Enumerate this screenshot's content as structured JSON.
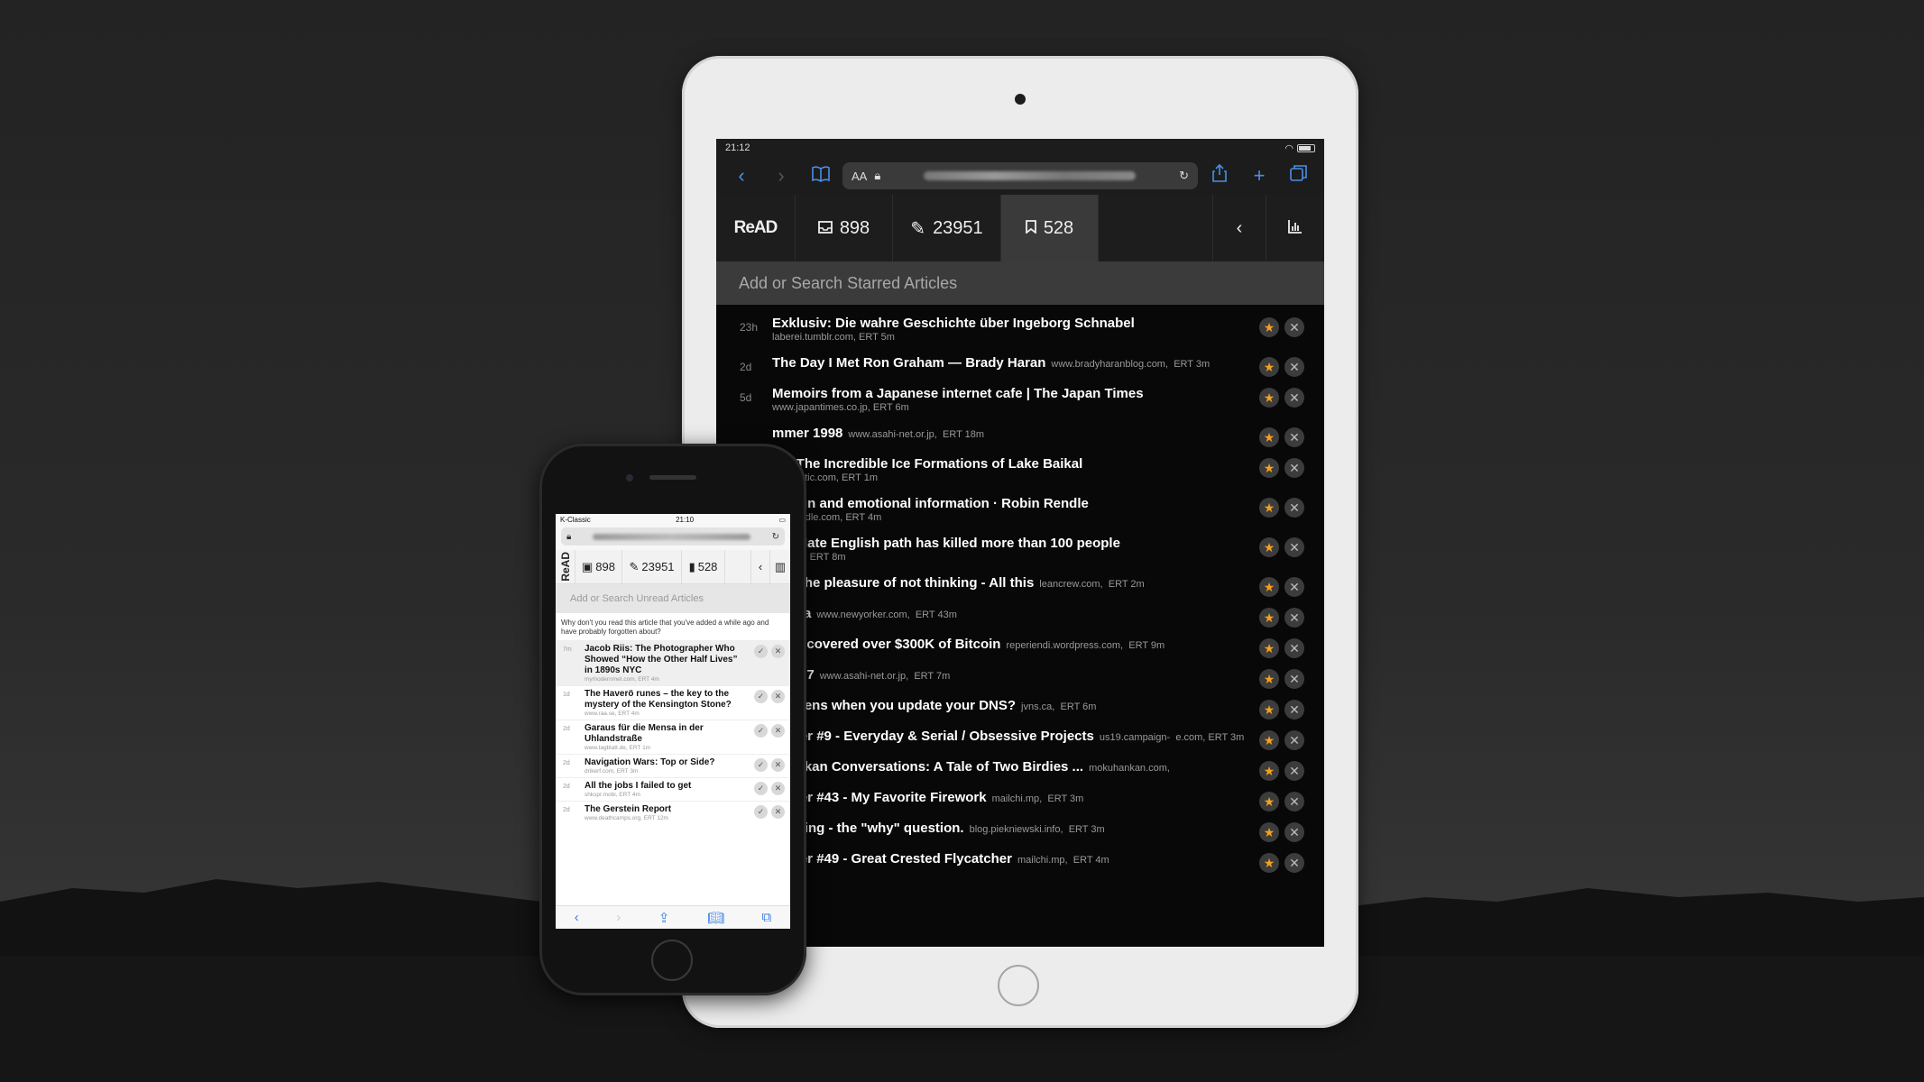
{
  "ipad": {
    "status_time": "21:12",
    "url_aa": "AA",
    "nav": {
      "logo": "ReAD",
      "unread_count": "898",
      "archived_count": "23951",
      "starred_count": "528",
      "back_symbol": "‹"
    },
    "search_placeholder": "Add or Search Starred Articles",
    "articles": [
      {
        "age": "23h",
        "title": "Exklusiv: Die wahre Geschichte über Ingeborg Schnabel",
        "domain": "laberei.tumblr.com,",
        "ert": "ERT 5m",
        "inline": false
      },
      {
        "age": "2d",
        "title": "The Day I Met Ron Graham — Brady Haran",
        "domain": "www.bradyharanblog.com,",
        "ert": "ERT 3m",
        "inline": true
      },
      {
        "age": "5d",
        "title": "Memoirs from a Japanese internet cafe | The Japan Times",
        "domain": "www.japantimes.co.jp,",
        "ert": "ERT 6m",
        "inline": false
      },
      {
        "age": "",
        "title": "mmer 1998",
        "domain": "www.asahi-net.or.jp,",
        "ert": "ERT 18m",
        "inline": true
      },
      {
        "age": "",
        "title": "os: The Incredible Ice Formations of Lake Baikal",
        "domain": "heatlantic.com,",
        "ert": "ERT 1m",
        "inline": false
      },
      {
        "age": "",
        "title": "design and emotional information · Robin Rendle",
        "domain": "bbinrendle.com,",
        "ert": "ERT 4m",
        "inline": false
      },
      {
        "age": "",
        "title": "desolate English path has killed more than 100 people",
        "domain": "pc.com,",
        "ert": "ERT 8m",
        "inline": false
      },
      {
        "age": "",
        "title": "and the pleasure of not thinking - All this",
        "domain": "leancrew.com,",
        "ert": "ERT 2m",
        "inline": true
      },
      {
        "age": "",
        "title": "shima",
        "domain": "www.newyorker.com,",
        "ert": "ERT 43m",
        "inline": true
      },
      {
        "age": "",
        "title": "we recovered over $300K of Bitcoin",
        "domain": "reperiendi.wordpress.com,",
        "ert": "ERT 9m",
        "inline": true
      },
      {
        "age": "",
        "title": "g 1997",
        "domain": "www.asahi-net.or.jp,",
        "ert": "ERT 7m",
        "inline": true
      },
      {
        "age": "",
        "title": "happens when you update your DNS?",
        "domain": "jvns.ca,",
        "ert": "ERT 6m",
        "inline": true
      },
      {
        "age": "",
        "title": "sletter #9 - Everyday & Serial / Obsessive Projects",
        "domain": "us19.campaign-",
        "ert": "e.com, ERT 3m",
        "inline": true
      },
      {
        "age": "",
        "title": "uhankan Conversations: A Tale of Two Birdies ...",
        "domain": "mokuhankan.com,",
        "ert": "",
        "inline": true
      },
      {
        "age": "",
        "title": "sletter #43 - My Favorite Firework",
        "domain": "mailchi.mp,",
        "ert": "ERT 3m",
        "inline": true
      },
      {
        "age": "",
        "title": "learning - the \"why\" question.",
        "domain": "blog.piekniewski.info,",
        "ert": "ERT 3m",
        "inline": true
      },
      {
        "age": "",
        "title": "sletter #49 - Great Crested Flycatcher",
        "domain": "mailchi.mp,",
        "ert": "ERT 4m",
        "inline": true
      }
    ]
  },
  "iphone": {
    "carrier": "K-Classic",
    "status_time": "21:10",
    "nav": {
      "logo": "ReAD",
      "unread_count": "898",
      "archived_count": "23951",
      "starred_count": "528"
    },
    "search_placeholder": "Add or Search Unread Articles",
    "prompt": "Why don't you read this article that you've added a while ago and have probably forgotten about?",
    "articles": [
      {
        "age": "7m",
        "title": "Jacob Riis: The Photographer Who Showed “How the Other Half Lives” in 1890s NYC",
        "sub": "mymodernmet.com, ERT 4m"
      },
      {
        "age": "1d",
        "title": "The Haverö runes – the key to the mystery of the Kensington Stone?",
        "sub": "www.raa.se, ERT 4m"
      },
      {
        "age": "2d",
        "title": "Garaus für die Mensa in der Uhlandstraße",
        "sub": "www.tagblatt.de, ERT 1m"
      },
      {
        "age": "2d",
        "title": "Navigation Wars: Top or Side?",
        "sub": "drikerf.com, ERT 3m"
      },
      {
        "age": "2d",
        "title": "All the jobs I failed to get",
        "sub": "shkspr.mobi, ERT 4m"
      },
      {
        "age": "2d",
        "title": "The Gerstein Report",
        "sub": "www.deathcamps.org, ERT 12m"
      }
    ]
  },
  "colors": {
    "background": "#262626",
    "ipad_app_bg": "#080808",
    "star": "#f3a11d",
    "safari_blue": "#4a8fe7"
  }
}
